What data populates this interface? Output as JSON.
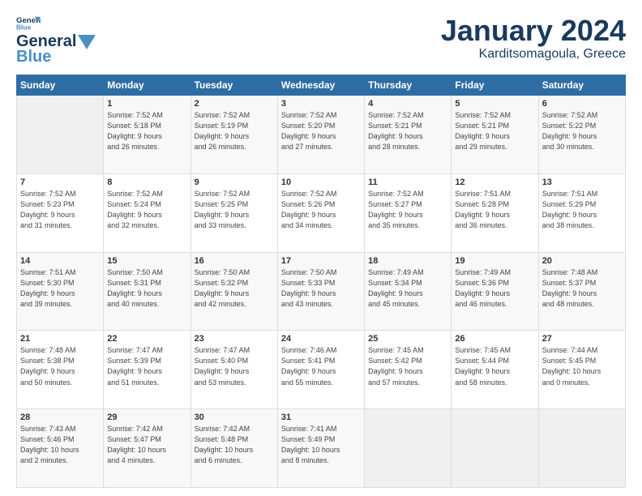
{
  "header": {
    "logo_line1": "General",
    "logo_line2": "Blue",
    "month": "January 2024",
    "location": "Karditsomagoula, Greece"
  },
  "weekdays": [
    "Sunday",
    "Monday",
    "Tuesday",
    "Wednesday",
    "Thursday",
    "Friday",
    "Saturday"
  ],
  "weeks": [
    [
      {
        "day": "",
        "info": ""
      },
      {
        "day": "1",
        "info": "Sunrise: 7:52 AM\nSunset: 5:18 PM\nDaylight: 9 hours\nand 26 minutes."
      },
      {
        "day": "2",
        "info": "Sunrise: 7:52 AM\nSunset: 5:19 PM\nDaylight: 9 hours\nand 26 minutes."
      },
      {
        "day": "3",
        "info": "Sunrise: 7:52 AM\nSunset: 5:20 PM\nDaylight: 9 hours\nand 27 minutes."
      },
      {
        "day": "4",
        "info": "Sunrise: 7:52 AM\nSunset: 5:21 PM\nDaylight: 9 hours\nand 28 minutes."
      },
      {
        "day": "5",
        "info": "Sunrise: 7:52 AM\nSunset: 5:21 PM\nDaylight: 9 hours\nand 29 minutes."
      },
      {
        "day": "6",
        "info": "Sunrise: 7:52 AM\nSunset: 5:22 PM\nDaylight: 9 hours\nand 30 minutes."
      }
    ],
    [
      {
        "day": "7",
        "info": "Sunrise: 7:52 AM\nSunset: 5:23 PM\nDaylight: 9 hours\nand 31 minutes."
      },
      {
        "day": "8",
        "info": "Sunrise: 7:52 AM\nSunset: 5:24 PM\nDaylight: 9 hours\nand 32 minutes."
      },
      {
        "day": "9",
        "info": "Sunrise: 7:52 AM\nSunset: 5:25 PM\nDaylight: 9 hours\nand 33 minutes."
      },
      {
        "day": "10",
        "info": "Sunrise: 7:52 AM\nSunset: 5:26 PM\nDaylight: 9 hours\nand 34 minutes."
      },
      {
        "day": "11",
        "info": "Sunrise: 7:52 AM\nSunset: 5:27 PM\nDaylight: 9 hours\nand 35 minutes."
      },
      {
        "day": "12",
        "info": "Sunrise: 7:51 AM\nSunset: 5:28 PM\nDaylight: 9 hours\nand 36 minutes."
      },
      {
        "day": "13",
        "info": "Sunrise: 7:51 AM\nSunset: 5:29 PM\nDaylight: 9 hours\nand 38 minutes."
      }
    ],
    [
      {
        "day": "14",
        "info": "Sunrise: 7:51 AM\nSunset: 5:30 PM\nDaylight: 9 hours\nand 39 minutes."
      },
      {
        "day": "15",
        "info": "Sunrise: 7:50 AM\nSunset: 5:31 PM\nDaylight: 9 hours\nand 40 minutes."
      },
      {
        "day": "16",
        "info": "Sunrise: 7:50 AM\nSunset: 5:32 PM\nDaylight: 9 hours\nand 42 minutes."
      },
      {
        "day": "17",
        "info": "Sunrise: 7:50 AM\nSunset: 5:33 PM\nDaylight: 9 hours\nand 43 minutes."
      },
      {
        "day": "18",
        "info": "Sunrise: 7:49 AM\nSunset: 5:34 PM\nDaylight: 9 hours\nand 45 minutes."
      },
      {
        "day": "19",
        "info": "Sunrise: 7:49 AM\nSunset: 5:36 PM\nDaylight: 9 hours\nand 46 minutes."
      },
      {
        "day": "20",
        "info": "Sunrise: 7:48 AM\nSunset: 5:37 PM\nDaylight: 9 hours\nand 48 minutes."
      }
    ],
    [
      {
        "day": "21",
        "info": "Sunrise: 7:48 AM\nSunset: 5:38 PM\nDaylight: 9 hours\nand 50 minutes."
      },
      {
        "day": "22",
        "info": "Sunrise: 7:47 AM\nSunset: 5:39 PM\nDaylight: 9 hours\nand 51 minutes."
      },
      {
        "day": "23",
        "info": "Sunrise: 7:47 AM\nSunset: 5:40 PM\nDaylight: 9 hours\nand 53 minutes."
      },
      {
        "day": "24",
        "info": "Sunrise: 7:46 AM\nSunset: 5:41 PM\nDaylight: 9 hours\nand 55 minutes."
      },
      {
        "day": "25",
        "info": "Sunrise: 7:45 AM\nSunset: 5:42 PM\nDaylight: 9 hours\nand 57 minutes."
      },
      {
        "day": "26",
        "info": "Sunrise: 7:45 AM\nSunset: 5:44 PM\nDaylight: 9 hours\nand 58 minutes."
      },
      {
        "day": "27",
        "info": "Sunrise: 7:44 AM\nSunset: 5:45 PM\nDaylight: 10 hours\nand 0 minutes."
      }
    ],
    [
      {
        "day": "28",
        "info": "Sunrise: 7:43 AM\nSunset: 5:46 PM\nDaylight: 10 hours\nand 2 minutes."
      },
      {
        "day": "29",
        "info": "Sunrise: 7:42 AM\nSunset: 5:47 PM\nDaylight: 10 hours\nand 4 minutes."
      },
      {
        "day": "30",
        "info": "Sunrise: 7:42 AM\nSunset: 5:48 PM\nDaylight: 10 hours\nand 6 minutes."
      },
      {
        "day": "31",
        "info": "Sunrise: 7:41 AM\nSunset: 5:49 PM\nDaylight: 10 hours\nand 8 minutes."
      },
      {
        "day": "",
        "info": ""
      },
      {
        "day": "",
        "info": ""
      },
      {
        "day": "",
        "info": ""
      }
    ]
  ]
}
